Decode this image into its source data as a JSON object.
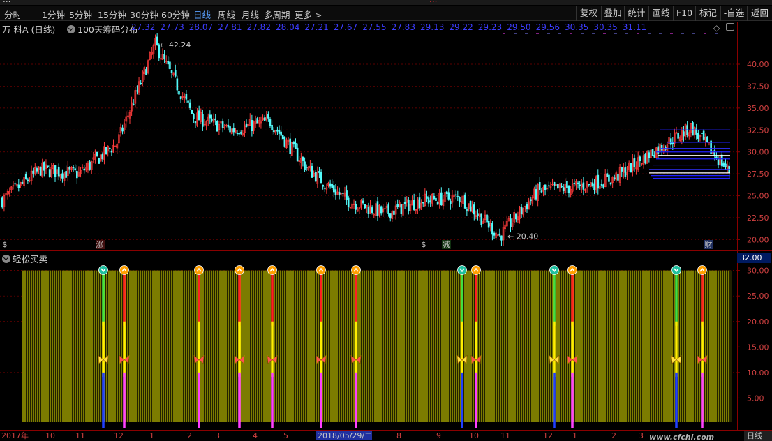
{
  "top_bar": {
    "text": "...",
    "title": "..."
  },
  "period_bar": {
    "items": [
      "分时",
      "1分钟",
      "5分钟",
      "15分钟",
      "30分钟",
      "60分钟",
      "日线",
      "周线",
      "月线",
      "多周期",
      "更多 >"
    ],
    "active": "日线",
    "right_items": [
      "复权",
      "叠加",
      "统计",
      "画线",
      "F10",
      "标记",
      "-自选",
      "返回"
    ]
  },
  "info_bar": {
    "stock": "万 科A (日线)",
    "indicator": "100天筹码分布",
    "prices": [
      "27.32",
      "27.73",
      "28.07",
      "27.81",
      "27.82",
      "28.04",
      "27.21",
      "27.67",
      "27.55",
      "27.83",
      "29.13",
      "29.22",
      "29.23",
      "29.50",
      "29.56",
      "30.35",
      "30.35",
      "31.11"
    ]
  },
  "main_chart": {
    "y_ticks": [
      "40.00",
      "37.50",
      "35.00",
      "32.50",
      "30.00",
      "27.50",
      "25.00",
      "22.50",
      "20.00"
    ],
    "y_min": 19.0,
    "y_max": 43.5,
    "high_label": "42.24",
    "low_label": "20.40",
    "markers": [
      {
        "text": "$",
        "color": "#e03030",
        "bg": "#000"
      },
      {
        "text": "涨",
        "color": "#ff4040",
        "bg": "#401010"
      },
      {
        "text": "$",
        "color": "#e03030",
        "bg": "#000"
      },
      {
        "text": "减",
        "color": "#30e060",
        "bg": "#103010"
      },
      {
        "text": "财",
        "color": "#fff",
        "bg": "#203060"
      }
    ]
  },
  "indicator_panel": {
    "name": "轻松买卖",
    "value_label": "32.00",
    "y_ticks": [
      "30.00",
      "25.00",
      "20.00",
      "15.00",
      "10.00",
      "5.00"
    ],
    "y_min": 0,
    "y_max": 32,
    "signals": [
      {
        "type": "buy"
      },
      {
        "type": "sell"
      },
      {
        "type": "sell"
      },
      {
        "type": "sell"
      },
      {
        "type": "sell"
      },
      {
        "type": "sell"
      },
      {
        "type": "sell"
      },
      {
        "type": "buy"
      },
      {
        "type": "sell"
      },
      {
        "type": "buy"
      },
      {
        "type": "sell"
      },
      {
        "type": "buy"
      },
      {
        "type": "sell"
      }
    ]
  },
  "date_axis": {
    "labels": [
      "2017年",
      "10",
      "11",
      "12",
      "1",
      "2",
      "3",
      "4",
      "5",
      "2018/05/29/二",
      "8",
      "9",
      "10",
      "11",
      "12",
      "1",
      "2",
      "3"
    ],
    "current_date": "2018/05/29/二",
    "period_tag": "日线"
  },
  "watermark": "www.cfchi.com",
  "colors": {
    "up": "#ff3c3c",
    "down": "#54fcfc",
    "grid": "#7a0000",
    "axis_text": "#d04040",
    "chip_blue": "#2020ff",
    "buy_icon": "#20c0a0",
    "sell_icon": "#ffa000",
    "yellow_bars": "#b8b800"
  },
  "chart_data": {
    "type": "candlestick",
    "title": "万 科A (日线)",
    "approx_close_path": [
      {
        "x": "2017-09",
        "y": 24.5
      },
      {
        "x": "2017-10",
        "y": 28.0
      },
      {
        "x": "2017-11",
        "y": 27.5
      },
      {
        "x": "2017-12",
        "y": 31.0
      },
      {
        "x": "2018-01",
        "y": 42.24
      },
      {
        "x": "2018-02",
        "y": 34.0
      },
      {
        "x": "2018-03",
        "y": 32.5
      },
      {
        "x": "2018-04",
        "y": 33.5
      },
      {
        "x": "2018-05",
        "y": 28.0
      },
      {
        "x": "2018-06",
        "y": 24.5
      },
      {
        "x": "2018-07",
        "y": 23.0
      },
      {
        "x": "2018-08",
        "y": 24.5
      },
      {
        "x": "2018-09",
        "y": 24.8
      },
      {
        "x": "2018-10",
        "y": 20.4
      },
      {
        "x": "2018-11",
        "y": 25.5
      },
      {
        "x": "2018-12",
        "y": 26.0
      },
      {
        "x": "2019-01",
        "y": 27.0
      },
      {
        "x": "2019-02",
        "y": 30.0
      },
      {
        "x": "2019-03",
        "y": 32.8
      },
      {
        "x": "2019-04",
        "y": 27.8
      }
    ],
    "ylim": [
      19.0,
      43.5
    ]
  }
}
